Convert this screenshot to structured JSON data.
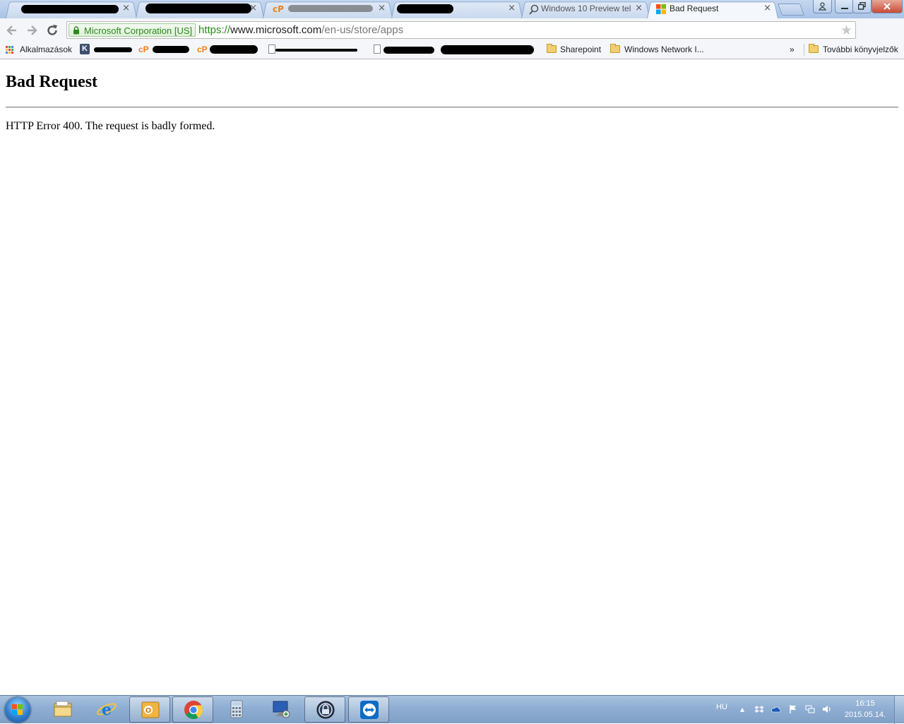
{
  "tabs": [
    {
      "title": "",
      "redacted": true
    },
    {
      "title": "",
      "redacted": true
    },
    {
      "title": "",
      "redacted": true,
      "favicon": "cP"
    },
    {
      "title": "",
      "redacted": true
    },
    {
      "title": "Windows 10 Preview tel",
      "favicon": "search-icon"
    },
    {
      "title": "Bad Request",
      "favicon": "microsoft-logo-icon",
      "active": true
    }
  ],
  "tab_close_glyph": "×",
  "window_buttons": {
    "user": "user-icon",
    "minimize": "minimize-icon",
    "restore": "restore-icon",
    "close": "close-icon"
  },
  "omnibox": {
    "ev_label": "Microsoft Corporation [US]",
    "url_scheme": "https://",
    "url_host": "www.microsoft.com",
    "url_path": "/en-us/store/apps"
  },
  "bookmarks": {
    "apps_label": "Alkalmazások",
    "items": [
      {
        "label": "Sharepoint",
        "icon": "folder-icon"
      },
      {
        "label": "Windows Network I...",
        "icon": "folder-icon"
      }
    ],
    "overflow": "»",
    "other_label": "További könyvjelzők"
  },
  "page": {
    "title": "Bad Request",
    "message": "HTTP Error 400. The request is badly formed."
  },
  "taskbar": {
    "pinned": [
      "windows-explorer-icon",
      "internet-explorer-icon",
      "outlook-icon",
      "chrome-icon",
      "calculator-icon",
      "remote-desktop-icon",
      "keepass-icon",
      "teamviewer-icon"
    ],
    "language": "HU",
    "time": "16:15",
    "date": "2015.05.14."
  },
  "colors": {
    "ev_green": "#2a8a1a",
    "chrome_frame": "#a9c3e6",
    "taskbar": "#8eaed2"
  }
}
